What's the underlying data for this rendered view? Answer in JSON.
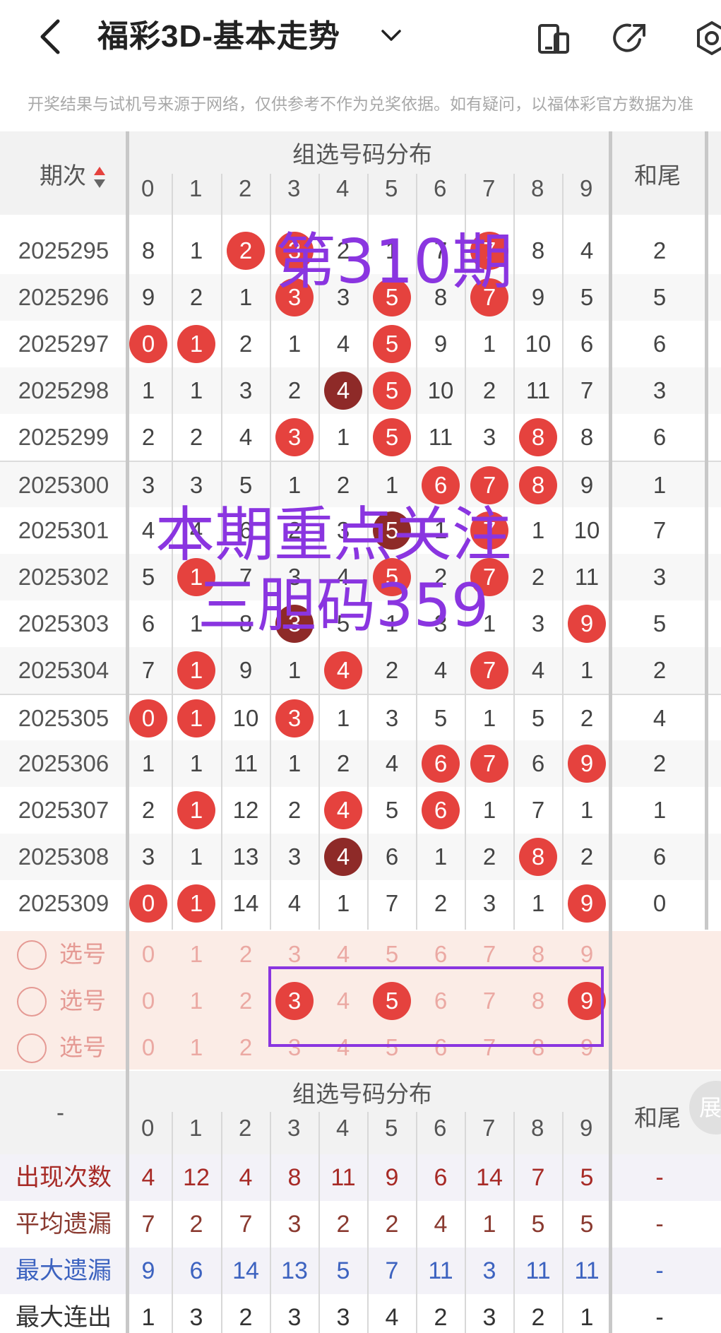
{
  "header": {
    "title": "福彩3D-基本走势"
  },
  "notice": "开奖结果与试机号来源于网络，仅供参考不作为兑奖依据。如有疑问，以福体彩官方数据为准",
  "table": {
    "col_period": "期次",
    "col_group": "组选号码分布",
    "col_tail": "和尾",
    "digits": [
      "0",
      "1",
      "2",
      "3",
      "4",
      "5",
      "6",
      "7",
      "8",
      "9"
    ],
    "rows": [
      {
        "p": "2025295",
        "v": [
          "8",
          "1",
          "2",
          "3",
          "2",
          "1",
          "7",
          "7",
          "8",
          "4"
        ],
        "t": "2"
      },
      {
        "p": "2025296",
        "v": [
          "9",
          "2",
          "1",
          "3",
          "3",
          "5",
          "8",
          "7",
          "9",
          "5"
        ],
        "t": "5"
      },
      {
        "p": "2025297",
        "v": [
          "0",
          "1",
          "2",
          "1",
          "4",
          "5",
          "9",
          "1",
          "10",
          "6"
        ],
        "t": "6"
      },
      {
        "p": "2025298",
        "v": [
          "1",
          "1",
          "3",
          "2",
          "4",
          "5",
          "10",
          "2",
          "11",
          "7"
        ],
        "t": "3"
      },
      {
        "p": "2025299",
        "v": [
          "2",
          "2",
          "4",
          "3",
          "1",
          "5",
          "11",
          "3",
          "8",
          "8"
        ],
        "t": "6"
      },
      {
        "p": "2025300",
        "v": [
          "3",
          "3",
          "5",
          "1",
          "2",
          "1",
          "6",
          "7",
          "8",
          "9"
        ],
        "t": "1"
      },
      {
        "p": "2025301",
        "v": [
          "4",
          "4",
          "6",
          "2",
          "3",
          "5",
          "1",
          "7",
          "1",
          "10"
        ],
        "t": "7"
      },
      {
        "p": "2025302",
        "v": [
          "5",
          "1",
          "7",
          "3",
          "4",
          "5",
          "2",
          "7",
          "2",
          "11"
        ],
        "t": "3"
      },
      {
        "p": "2025303",
        "v": [
          "6",
          "1",
          "8",
          "3",
          "5",
          "1",
          "3",
          "1",
          "3",
          "9"
        ],
        "t": "5"
      },
      {
        "p": "2025304",
        "v": [
          "7",
          "1",
          "9",
          "1",
          "4",
          "2",
          "4",
          "7",
          "4",
          "1"
        ],
        "t": "2"
      },
      {
        "p": "2025305",
        "v": [
          "0",
          "1",
          "10",
          "3",
          "1",
          "3",
          "5",
          "1",
          "5",
          "2"
        ],
        "t": "4"
      },
      {
        "p": "2025306",
        "v": [
          "1",
          "1",
          "11",
          "1",
          "2",
          "4",
          "6",
          "7",
          "6",
          "9"
        ],
        "t": "2"
      },
      {
        "p": "2025307",
        "v": [
          "2",
          "1",
          "12",
          "2",
          "4",
          "5",
          "6",
          "1",
          "7",
          "1"
        ],
        "t": "1"
      },
      {
        "p": "2025308",
        "v": [
          "3",
          "1",
          "13",
          "3",
          "4",
          "6",
          "1",
          "2",
          "8",
          "2"
        ],
        "t": "6"
      },
      {
        "p": "2025309",
        "v": [
          "0",
          "1",
          "14",
          "4",
          "1",
          "7",
          "2",
          "3",
          "1",
          "9"
        ],
        "t": "0"
      }
    ]
  },
  "pick": {
    "label": "选号"
  },
  "stats": {
    "dash": "-",
    "rows": [
      {
        "label": "出现次数",
        "values": [
          "4",
          "12",
          "4",
          "8",
          "11",
          "9",
          "6",
          "14",
          "7",
          "5"
        ],
        "tail": "-"
      },
      {
        "label": "平均遗漏",
        "values": [
          "7",
          "2",
          "7",
          "3",
          "2",
          "2",
          "4",
          "1",
          "5",
          "5"
        ],
        "tail": "-"
      },
      {
        "label": "最大遗漏",
        "values": [
          "9",
          "6",
          "14",
          "13",
          "5",
          "7",
          "11",
          "3",
          "11",
          "11"
        ],
        "tail": "-"
      },
      {
        "label": "最大连出",
        "values": [
          "1",
          "3",
          "2",
          "3",
          "3",
          "4",
          "2",
          "3",
          "2",
          "1"
        ],
        "tail": "-"
      }
    ]
  },
  "expand_label": "展",
  "overlay": {
    "line1": "第310期",
    "line2": "本期重点关注",
    "line3": "三胆码359"
  },
  "colors": {
    "ball": "#e5423e",
    "ball_dark": "#8e2a28",
    "overlay": "#8a35e0"
  }
}
